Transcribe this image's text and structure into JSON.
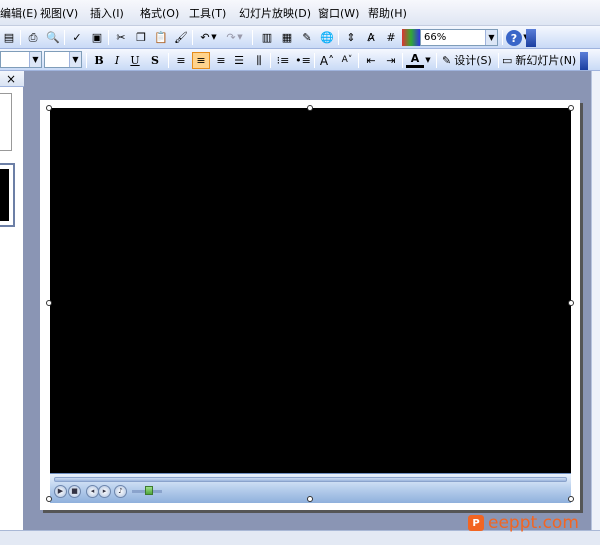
{
  "menu": {
    "items": [
      "编辑(E)",
      "视图(V)",
      "插入(I)",
      "格式(O)",
      "工具(T)",
      "幻灯片放映(D)",
      "窗口(W)",
      "帮助(H)"
    ]
  },
  "toolbar": {
    "zoom_value": "66%",
    "design_label": "设计(S)",
    "new_slide_label": "新幻灯片(N)"
  },
  "format_toolbar": {
    "bold": "B",
    "italic": "I",
    "underline": "U",
    "shadow": "S"
  },
  "pane": {
    "close_glyph": "×"
  },
  "watermark": {
    "text": "eeppt.com",
    "logo_letter": "P"
  },
  "colors": {
    "menubar": "#dfe6f3",
    "toolbar": "#c9daf6",
    "workspace": "#8a95b4",
    "watermark": "#f26522"
  }
}
